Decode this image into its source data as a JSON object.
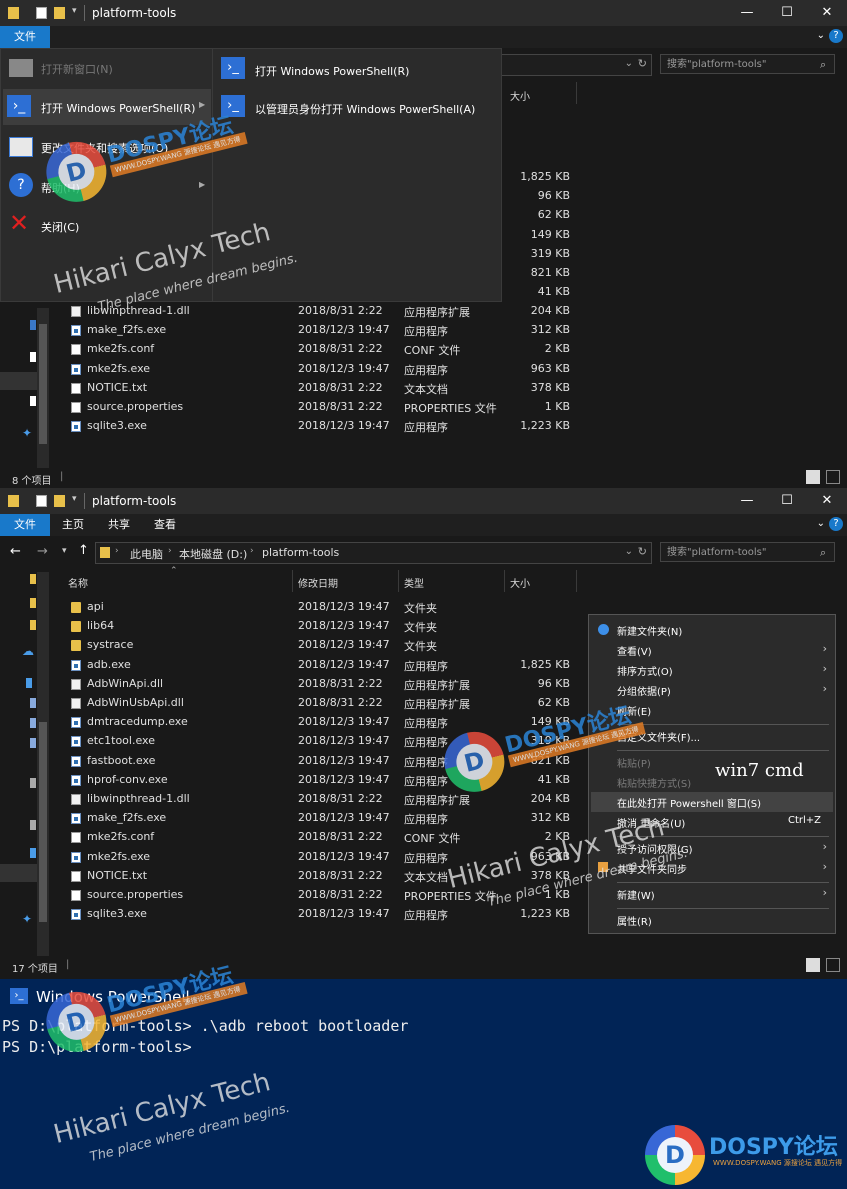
{
  "window": {
    "title": "platform-tools",
    "controls": [
      "—",
      "☐",
      "✕"
    ]
  },
  "ribbon": {
    "file": "文件",
    "tabs": [
      "主页",
      "共享",
      "查看"
    ]
  },
  "file_menu": {
    "items": [
      {
        "label": "打开新窗口(N)",
        "disabled": true,
        "icon": "window-icon"
      },
      {
        "label": "打开 Windows PowerShell(R)",
        "disabled": false,
        "icon": "powershell-icon",
        "submenu": true
      },
      {
        "label": "更改文件夹和搜索选项(O)",
        "disabled": false,
        "icon": "options-icon"
      },
      {
        "label": "帮助(H)",
        "disabled": false,
        "icon": "help-icon",
        "submenu": true
      },
      {
        "label": "关闭(C)",
        "disabled": false,
        "icon": "close-red-icon"
      }
    ],
    "submenu": [
      {
        "label": "打开 Windows PowerShell(R)",
        "icon": "powershell-icon"
      },
      {
        "label": "以管理员身份打开 Windows PowerShell(A)",
        "icon": "powershell-admin-icon"
      }
    ]
  },
  "address": {
    "crumbs": [
      "此电脑",
      "本地磁盘 (D:)",
      "platform-tools"
    ],
    "search_placeholder": "搜索\"platform-tools\""
  },
  "columns": {
    "name": "名称",
    "date": "修改日期",
    "type": "类型",
    "size": "大小"
  },
  "top_window": {
    "partial_sizes": [
      "1,825 KB",
      "96 KB",
      "62 KB",
      "149 KB",
      "319 KB",
      "821 KB",
      "41 KB"
    ],
    "files": [
      {
        "name": "libwinpthread-1.dll",
        "date": "2018/8/31 2:22",
        "type": "应用程序扩展",
        "size": "204 KB",
        "kind": "dll"
      },
      {
        "name": "make_f2fs.exe",
        "date": "2018/12/3 19:47",
        "type": "应用程序",
        "size": "312 KB",
        "kind": "exe"
      },
      {
        "name": "mke2fs.conf",
        "date": "2018/8/31 2:22",
        "type": "CONF 文件",
        "size": "2 KB",
        "kind": "txt"
      },
      {
        "name": "mke2fs.exe",
        "date": "2018/12/3 19:47",
        "type": "应用程序",
        "size": "963 KB",
        "kind": "exe"
      },
      {
        "name": "NOTICE.txt",
        "date": "2018/8/31 2:22",
        "type": "文本文档",
        "size": "378 KB",
        "kind": "txt"
      },
      {
        "name": "source.properties",
        "date": "2018/8/31 2:22",
        "type": "PROPERTIES 文件",
        "size": "1 KB",
        "kind": "txt"
      },
      {
        "name": "sqlite3.exe",
        "date": "2018/12/3 19:47",
        "type": "应用程序",
        "size": "1,223 KB",
        "kind": "exe"
      }
    ],
    "status": "8 个项目"
  },
  "bottom_window": {
    "files": [
      {
        "name": "api",
        "date": "2018/12/3 19:47",
        "type": "文件夹",
        "size": "",
        "kind": "folder"
      },
      {
        "name": "lib64",
        "date": "2018/12/3 19:47",
        "type": "文件夹",
        "size": "",
        "kind": "folder"
      },
      {
        "name": "systrace",
        "date": "2018/12/3 19:47",
        "type": "文件夹",
        "size": "",
        "kind": "folder"
      },
      {
        "name": "adb.exe",
        "date": "2018/12/3 19:47",
        "type": "应用程序",
        "size": "1,825 KB",
        "kind": "exe"
      },
      {
        "name": "AdbWinApi.dll",
        "date": "2018/8/31 2:22",
        "type": "应用程序扩展",
        "size": "96 KB",
        "kind": "dll"
      },
      {
        "name": "AdbWinUsbApi.dll",
        "date": "2018/8/31 2:22",
        "type": "应用程序扩展",
        "size": "62 KB",
        "kind": "dll"
      },
      {
        "name": "dmtracedump.exe",
        "date": "2018/12/3 19:47",
        "type": "应用程序",
        "size": "149 KB",
        "kind": "exe"
      },
      {
        "name": "etc1tool.exe",
        "date": "2018/12/3 19:47",
        "type": "应用程序",
        "size": "319 KB",
        "kind": "exe"
      },
      {
        "name": "fastboot.exe",
        "date": "2018/12/3 19:47",
        "type": "应用程序",
        "size": "821 KB",
        "kind": "exe"
      },
      {
        "name": "hprof-conv.exe",
        "date": "2018/12/3 19:47",
        "type": "应用程序",
        "size": "41 KB",
        "kind": "exe"
      },
      {
        "name": "libwinpthread-1.dll",
        "date": "2018/8/31 2:22",
        "type": "应用程序扩展",
        "size": "204 KB",
        "kind": "dll"
      },
      {
        "name": "make_f2fs.exe",
        "date": "2018/12/3 19:47",
        "type": "应用程序",
        "size": "312 KB",
        "kind": "exe"
      },
      {
        "name": "mke2fs.conf",
        "date": "2018/8/31 2:22",
        "type": "CONF 文件",
        "size": "2 KB",
        "kind": "txt"
      },
      {
        "name": "mke2fs.exe",
        "date": "2018/12/3 19:47",
        "type": "应用程序",
        "size": "963 KB",
        "kind": "exe"
      },
      {
        "name": "NOTICE.txt",
        "date": "2018/8/31 2:22",
        "type": "文本文档",
        "size": "378 KB",
        "kind": "txt"
      },
      {
        "name": "source.properties",
        "date": "2018/8/31 2:22",
        "type": "PROPERTIES 文件",
        "size": "1 KB",
        "kind": "txt"
      },
      {
        "name": "sqlite3.exe",
        "date": "2018/12/3 19:47",
        "type": "应用程序",
        "size": "1,223 KB",
        "kind": "exe"
      }
    ],
    "status": "17 个项目"
  },
  "context_menu": {
    "items": [
      {
        "label": "新建文件夹(N)",
        "disabled": false,
        "arrow": false,
        "shortcut": "",
        "icon": "new-folder-icon"
      },
      {
        "label": "查看(V)",
        "disabled": false,
        "arrow": true,
        "shortcut": ""
      },
      {
        "label": "排序方式(O)",
        "disabled": false,
        "arrow": true,
        "shortcut": ""
      },
      {
        "label": "分组依据(P)",
        "disabled": false,
        "arrow": true,
        "shortcut": ""
      },
      {
        "label": "刷新(E)",
        "disabled": false,
        "arrow": false,
        "shortcut": ""
      },
      {
        "sep": true
      },
      {
        "label": "自定义文件夹(F)...",
        "disabled": false,
        "arrow": false,
        "shortcut": ""
      },
      {
        "sep": true
      },
      {
        "label": "粘贴(P)",
        "disabled": true,
        "arrow": false,
        "shortcut": ""
      },
      {
        "label": "粘贴快捷方式(S)",
        "disabled": true,
        "arrow": false,
        "shortcut": ""
      },
      {
        "label": "在此处打开 Powershell 窗口(S)",
        "disabled": false,
        "arrow": false,
        "shortcut": "",
        "highlight": true
      },
      {
        "label": "撤消 重命名(U)",
        "disabled": false,
        "arrow": false,
        "shortcut": "Ctrl+Z"
      },
      {
        "sep": true
      },
      {
        "label": "授予访问权限(G)",
        "disabled": false,
        "arrow": true,
        "shortcut": ""
      },
      {
        "label": "共享文件夹同步",
        "disabled": false,
        "arrow": true,
        "shortcut": "",
        "icon": "sync-icon"
      },
      {
        "sep": true
      },
      {
        "label": "新建(W)",
        "disabled": false,
        "arrow": true,
        "shortcut": ""
      },
      {
        "sep": true
      },
      {
        "label": "属性(R)",
        "disabled": false,
        "arrow": false,
        "shortcut": ""
      }
    ]
  },
  "annotation": "win7 cmd",
  "powershell": {
    "title": "Windows PowerShell",
    "lines": [
      "PS D:\\platform-tools> .\\adb reboot bootloader",
      "PS D:\\platform-tools>"
    ]
  },
  "watermarks": {
    "brand": "Hikari Calyx Tech",
    "tagline": "The place where dream begins.",
    "forum": "DOSPY论坛",
    "forum_url": "WWW.DOSPY.WANG 源搜论坛 遇见方得"
  }
}
